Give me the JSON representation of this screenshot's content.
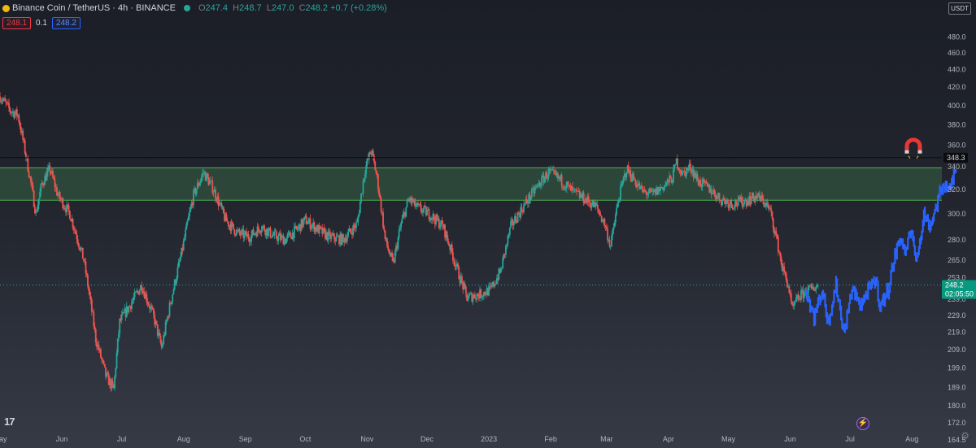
{
  "header": {
    "title": "Binance Coin / TetherUS · 4h · BINANCE",
    "ohlc": [
      {
        "k": "O",
        "v": "247.4"
      },
      {
        "k": "H",
        "v": "248.7"
      },
      {
        "k": "L",
        "v": "247.0"
      },
      {
        "k": "C",
        "v": "248.2 +0.7 (+0.28%)"
      }
    ]
  },
  "legend": {
    "red_value": "248.1",
    "mid_value": "0.1",
    "blue_value": "248.2"
  },
  "currency_label": "USDT",
  "countdown": "02:05:50",
  "logo_text": "17",
  "colors": {
    "up": "#26a69a",
    "down": "#ef5350",
    "projection": "#2962ff",
    "zone": "#2e4d3c",
    "zone_border": "#4caf50",
    "resistance": "#0b0c0f"
  },
  "icons": {
    "magnet": "magnet-icon",
    "bolt": "lightning-icon",
    "settings": "gear-icon"
  },
  "chart_data": {
    "type": "candlestick",
    "symbol": "Binance Coin / TetherUS",
    "interval": "4h",
    "y_scale": "log",
    "y_ticks": [
      164.5,
      172.0,
      180.0,
      189.0,
      199.0,
      209.0,
      219.0,
      229.0,
      239.0,
      253.0,
      265.0,
      280.0,
      300.0,
      320.0,
      340.0,
      360.0,
      380.0,
      400.0,
      420.0,
      440.0,
      460.0,
      480.0
    ],
    "ylim": [
      163,
      505
    ],
    "x_labels": [
      "May",
      "Jun",
      "Jul",
      "Aug",
      "Sep",
      "Oct",
      "Nov",
      "Dec",
      "2023",
      "Feb",
      "Mar",
      "Apr",
      "May",
      "Jun",
      "Jul",
      "Aug"
    ],
    "x_label_days": [
      0,
      31,
      61,
      92,
      123,
      153,
      184,
      214,
      245,
      276,
      304,
      335,
      365,
      396,
      426,
      457
    ],
    "x_range_days": [
      0,
      472
    ],
    "current_price": 248.2,
    "resistance_level": 348.3,
    "zone": [
      311,
      339
    ],
    "price_path": [
      [
        0,
        410
      ],
      [
        5,
        395
      ],
      [
        9,
        390
      ],
      [
        14,
        340
      ],
      [
        18,
        300
      ],
      [
        21,
        325
      ],
      [
        25,
        338
      ],
      [
        29,
        315
      ],
      [
        35,
        300
      ],
      [
        42,
        265
      ],
      [
        48,
        215
      ],
      [
        53,
        195
      ],
      [
        57,
        188
      ],
      [
        60,
        225
      ],
      [
        65,
        235
      ],
      [
        71,
        248
      ],
      [
        77,
        228
      ],
      [
        81,
        210
      ],
      [
        86,
        240
      ],
      [
        91,
        270
      ],
      [
        97,
        315
      ],
      [
        102,
        335
      ],
      [
        107,
        320
      ],
      [
        113,
        295
      ],
      [
        119,
        285
      ],
      [
        125,
        282
      ],
      [
        131,
        290
      ],
      [
        137,
        283
      ],
      [
        143,
        280
      ],
      [
        149,
        288
      ],
      [
        153,
        295
      ],
      [
        159,
        288
      ],
      [
        165,
        282
      ],
      [
        172,
        280
      ],
      [
        179,
        292
      ],
      [
        183,
        338
      ],
      [
        186,
        355
      ],
      [
        189,
        330
      ],
      [
        193,
        280
      ],
      [
        197,
        262
      ],
      [
        201,
        292
      ],
      [
        205,
        312
      ],
      [
        209,
        305
      ],
      [
        215,
        300
      ],
      [
        222,
        290
      ],
      [
        230,
        255
      ],
      [
        234,
        240
      ],
      [
        240,
        242
      ],
      [
        246,
        245
      ],
      [
        251,
        258
      ],
      [
        256,
        290
      ],
      [
        262,
        305
      ],
      [
        269,
        322
      ],
      [
        275,
        335
      ],
      [
        281,
        328
      ],
      [
        287,
        318
      ],
      [
        293,
        312
      ],
      [
        299,
        305
      ],
      [
        303,
        292
      ],
      [
        306,
        275
      ],
      [
        310,
        312
      ],
      [
        314,
        338
      ],
      [
        318,
        328
      ],
      [
        322,
        318
      ],
      [
        327,
        316
      ],
      [
        332,
        322
      ],
      [
        337,
        330
      ],
      [
        339,
        345
      ],
      [
        342,
        333
      ],
      [
        346,
        340
      ],
      [
        350,
        327
      ],
      [
        356,
        320
      ],
      [
        361,
        312
      ],
      [
        367,
        308
      ],
      [
        373,
        310
      ],
      [
        379,
        314
      ],
      [
        383,
        310
      ],
      [
        386,
        302
      ],
      [
        389,
        282
      ],
      [
        392,
        260
      ],
      [
        395,
        248
      ],
      [
        397,
        232
      ],
      [
        400,
        240
      ],
      [
        404,
        244
      ],
      [
        407,
        246
      ],
      [
        410,
        248
      ]
    ],
    "projection_path": [
      [
        404,
        244
      ],
      [
        408,
        228
      ],
      [
        412,
        245
      ],
      [
        415,
        225
      ],
      [
        419,
        248
      ],
      [
        423,
        218
      ],
      [
        427,
        246
      ],
      [
        431,
        235
      ],
      [
        435,
        244
      ],
      [
        439,
        252
      ],
      [
        441,
        234
      ],
      [
        445,
        245
      ],
      [
        448,
        265
      ],
      [
        451,
        282
      ],
      [
        454,
        270
      ],
      [
        457,
        290
      ],
      [
        459,
        262
      ],
      [
        463,
        300
      ],
      [
        466,
        290
      ],
      [
        469,
        305
      ],
      [
        473,
        326
      ],
      [
        476,
        318
      ],
      [
        479,
        341
      ]
    ]
  }
}
